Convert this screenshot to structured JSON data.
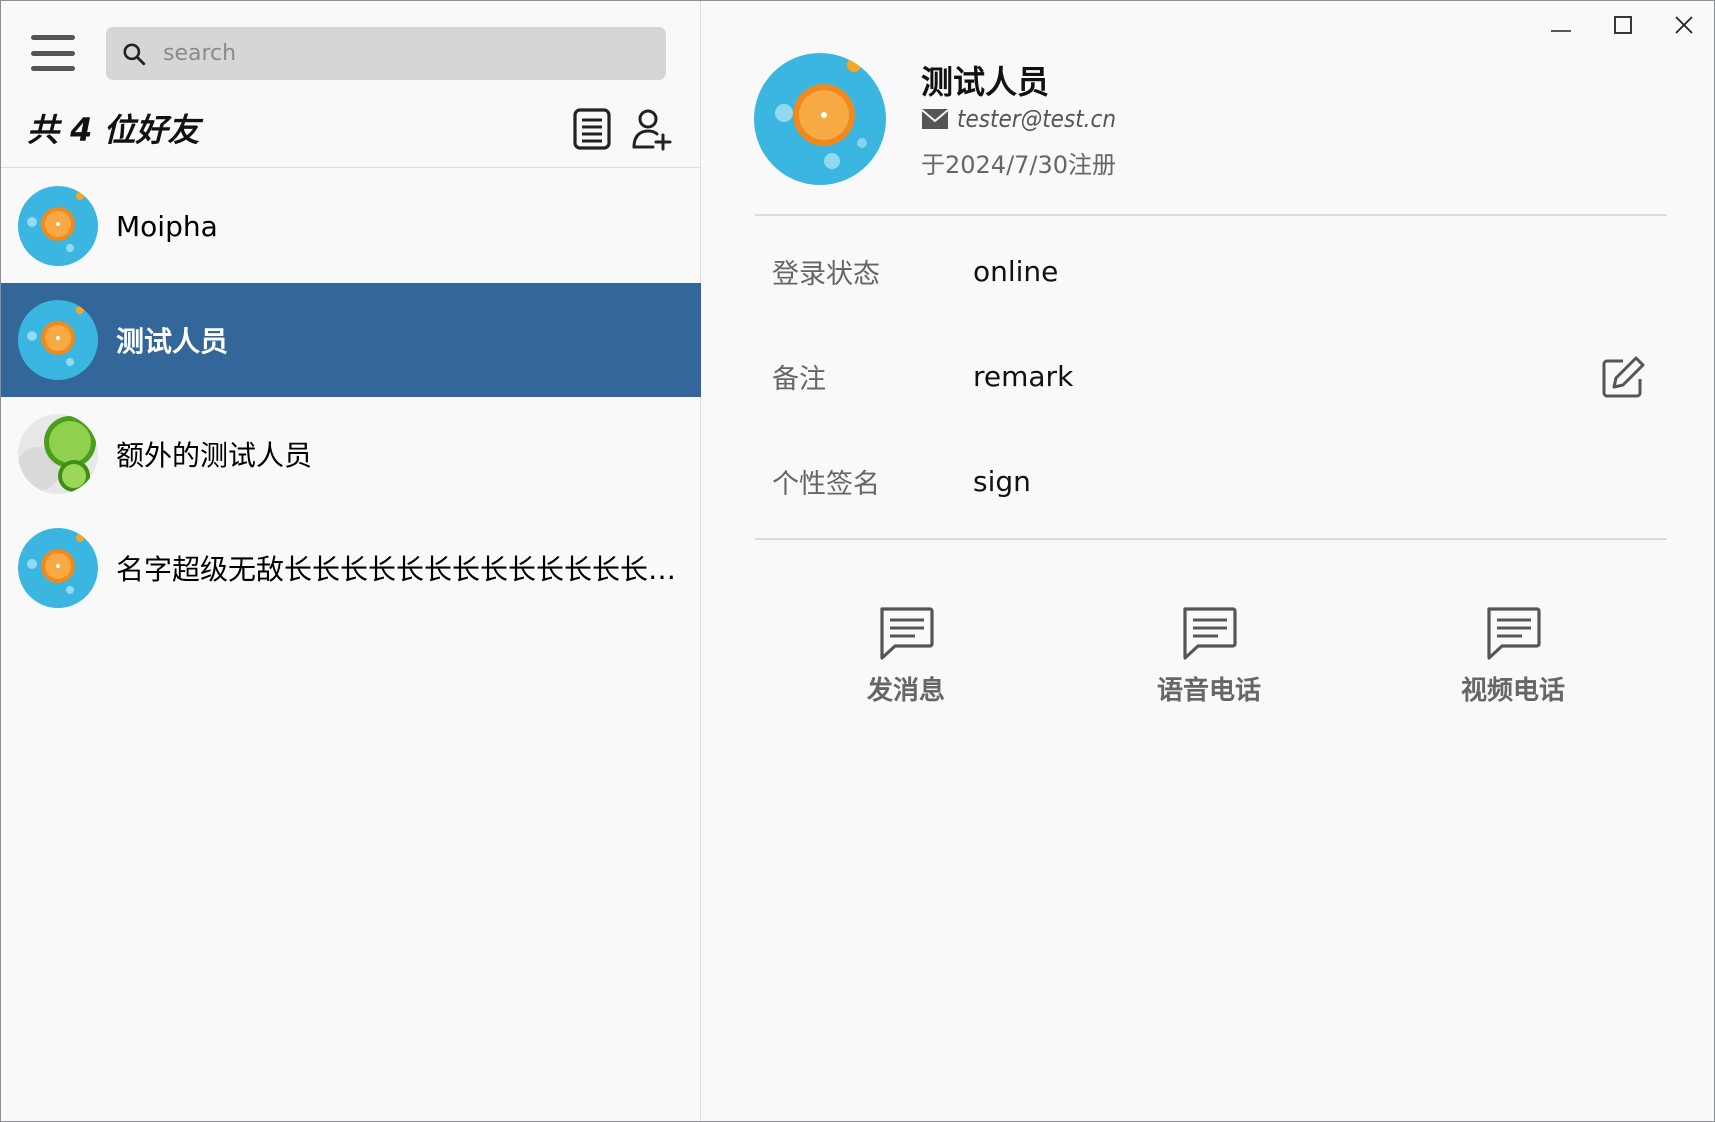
{
  "search": {
    "placeholder": "search"
  },
  "friend_count_label": "共 4 位好友",
  "friends": [
    {
      "name": "Moipha",
      "avatar": "orange-avatar"
    },
    {
      "name": "测试人员",
      "avatar": "orange-avatar",
      "selected": true
    },
    {
      "name": "额外的测试人员",
      "avatar": "lime-avatar"
    },
    {
      "name": "名字超级无敌长长长长长长长长长长长长长长长长长长长长长长长长长长长长长长长长长长长",
      "avatar": "orange-avatar"
    }
  ],
  "profile": {
    "name": "测试人员",
    "email": "tester@test.cn",
    "registered": "于2024/7/30注册"
  },
  "details": {
    "status_label": "登录状态",
    "status_value": "online",
    "remark_label": "备注",
    "remark_value": "remark",
    "signature_label": "个性签名",
    "signature_value": "sign"
  },
  "actions": {
    "message": "发消息",
    "voice_call": "语音电话",
    "video_call": "视频电话"
  },
  "icons": {
    "menu": "hamburger-icon",
    "search": "search-icon",
    "list": "list-icon",
    "add_friend": "add-user-icon",
    "mail": "mail-icon",
    "edit": "edit-icon",
    "chat": "chat-icon"
  },
  "colors": {
    "selected_row": "#336699",
    "search_bg": "#d6d6d6",
    "background": "#f9f9f9"
  }
}
